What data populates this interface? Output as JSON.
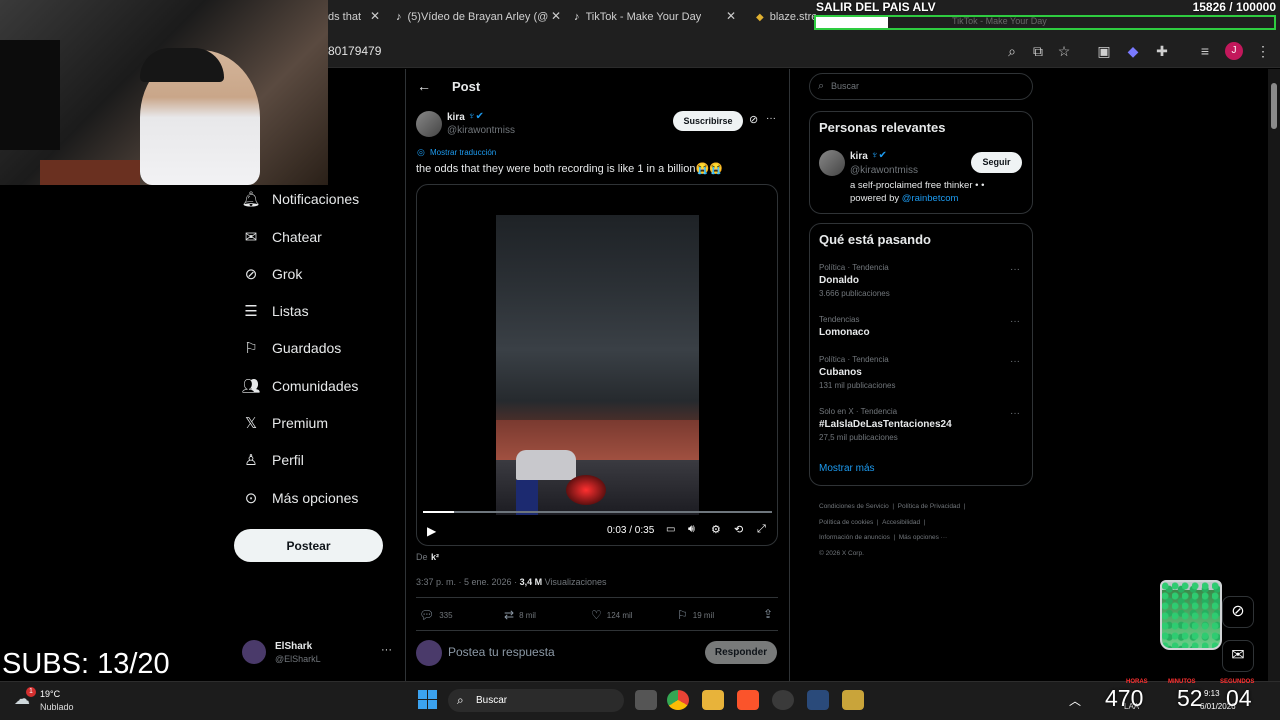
{
  "browser": {
    "tabs": [
      {
        "title": "ds that "
      },
      {
        "title": "(5)Vídeo de Brayan Arley (@"
      },
      {
        "title": "TikTok - Make Your Day"
      },
      {
        "title": "blaze.stream/alerta"
      }
    ],
    "url": "80179479"
  },
  "overlay": {
    "top_title": "SALIR DEL PAIS ALV",
    "goal": "15826 / 100000",
    "ghost_tab": "TikTok - Make Your Day",
    "subs": "SUBS: 13/20",
    "timer": {
      "hours": "470",
      "minutes": "52",
      "seconds": "04",
      "hours_label": "HORAS",
      "minutes_label": "MINUTOS",
      "seconds_label": "SEGUNDOS"
    }
  },
  "sidebar": {
    "items": [
      {
        "label": "Notificaciones",
        "icon": "bell-icon"
      },
      {
        "label": "Chatear",
        "icon": "mail-icon"
      },
      {
        "label": "Grok",
        "icon": "grok-icon"
      },
      {
        "label": "Listas",
        "icon": "list-icon"
      },
      {
        "label": "Guardados",
        "icon": "bookmark-icon"
      },
      {
        "label": "Comunidades",
        "icon": "communities-icon"
      },
      {
        "label": "Premium",
        "icon": "x-logo-icon"
      },
      {
        "label": "Perfil",
        "icon": "profile-icon"
      },
      {
        "label": "Más opciones",
        "icon": "more-icon"
      }
    ],
    "post_button": "Postear",
    "account": {
      "name": "ElShark",
      "handle": "@ElSharkL"
    }
  },
  "post": {
    "header": "Post",
    "author_name": "kira",
    "author_handle": "@kirawontmiss",
    "subscribe": "Suscribirse",
    "translate": "Mostrar traducción",
    "text": "the odds that they were both recording is like 1 in a billion😭😭",
    "video_time": "0:03 / 0:35",
    "video_progress": 0.09,
    "from_label": "De",
    "from_user": "k²",
    "meta_time": "3:37 p. m. · 5 ene. 2026 · ",
    "views_count": "3,4 M",
    "views_label": "Visualizaciones",
    "replies": "335",
    "reposts": "8 mil",
    "likes": "124 mil",
    "bookmarks": "19 mil",
    "reply_placeholder": "Postea tu respuesta",
    "reply_button": "Responder"
  },
  "right": {
    "search_placeholder": "Buscar",
    "relevant_title": "Personas relevantes",
    "relevant": {
      "name": "kira",
      "handle": "@kirawontmiss",
      "follow": "Seguir",
      "bio": "a self-proclaimed free thinker • •",
      "bio2_prefix": "powered by ",
      "bio2_link": "@rainbetcom"
    },
    "trending_title": "Qué está pasando",
    "trends": [
      {
        "context": "Política · Tendencia",
        "name": "Donaldo",
        "count": "3.666 publicaciones"
      },
      {
        "context": "Tendencias",
        "name": "Lomonaco",
        "count": ""
      },
      {
        "context": "Política · Tendencia",
        "name": "Cubanos",
        "count": "131 mil publicaciones"
      },
      {
        "context": "Solo en X · Tendencia",
        "name": "#LaIslaDeLasTentaciones24",
        "count": "27,5 mil publicaciones"
      }
    ],
    "show_more": "Mostrar más",
    "footer": [
      "Condiciones de Servicio",
      "Política de Privacidad",
      "Política de cookies",
      "Accesibilidad",
      "Información de anuncios",
      "Más opciones ···",
      "© 2026 X Corp."
    ]
  },
  "taskbar": {
    "weather_temp": "19°C",
    "weather_desc": "Nublado",
    "search": "Buscar",
    "clock_time": "9:13",
    "clock_date": "6/01/2026",
    "lang": "LAA"
  },
  "colors": {
    "accent": "#1d9bf0",
    "bg": "#000000",
    "text": "#e7e9ea",
    "muted": "#71767b"
  }
}
